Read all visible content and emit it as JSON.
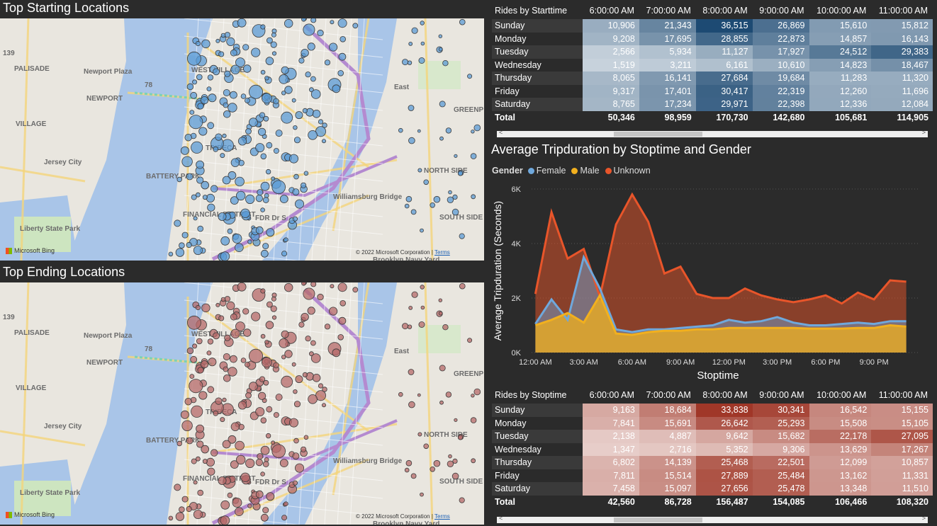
{
  "maps": [
    {
      "title": "Top Starting Locations",
      "labels": [
        "PALISADE",
        "Newport Plaza",
        "NEWPORT",
        "VILLAGE",
        "Jersey City",
        "WEST VILLAGE",
        "TRIBECA",
        "BATTERY PARK",
        "FINANCIAL DISTRICT",
        "Liberty State Park",
        "East",
        "GREENP",
        "NORTH SIDE",
        "SOUTH SIDE",
        "Brooklyn Navy Yard",
        "Williamsburg Bridge",
        "FDR Dr S",
        "78",
        "139"
      ],
      "bing": "Microsoft Bing",
      "copyright": "© 2022 Microsoft Corporation",
      "terms": "Terms",
      "bubble_color": "#5b9bd5"
    },
    {
      "title": "Top Ending Locations",
      "labels": [
        "PALISADE",
        "Newport Plaza",
        "NEWPORT",
        "VILLAGE",
        "Jersey City",
        "WEST VILLAGE",
        "TRIBECA",
        "BATTERY PARK",
        "FINANCIAL DISTRICT",
        "Liberty State Park",
        "East",
        "GREENP",
        "NORTH SIDE",
        "SOUTH SIDE",
        "Brooklyn Navy Yard",
        "Williamsburg Bridge",
        "FDR Dr S",
        "78",
        "139"
      ],
      "bing": "Microsoft Bing",
      "copyright": "© 2022 Microsoft Corporation",
      "terms": "Terms",
      "bubble_color": "#b56a6a"
    }
  ],
  "start_table": {
    "row_header": "Rides by Starttime",
    "columns": [
      "6:00:00 AM",
      "7:00:00 AM",
      "8:00:00 AM",
      "9:00:00 AM",
      "10:00:00 AM",
      "11:00:00 AM"
    ],
    "rows": [
      {
        "label": "Sunday",
        "values": [
          "10,906",
          "21,343",
          "36,515",
          "26,869",
          "15,610",
          "15,812"
        ]
      },
      {
        "label": "Monday",
        "values": [
          "9,208",
          "17,695",
          "28,855",
          "22,873",
          "14,857",
          "16,143"
        ]
      },
      {
        "label": "Tuesday",
        "values": [
          "2,566",
          "5,934",
          "11,127",
          "17,927",
          "24,512",
          "29,383"
        ]
      },
      {
        "label": "Wednesday",
        "values": [
          "1,519",
          "3,211",
          "6,161",
          "10,610",
          "14,823",
          "18,467"
        ]
      },
      {
        "label": "Thursday",
        "values": [
          "8,065",
          "16,141",
          "27,684",
          "19,684",
          "11,283",
          "11,320"
        ]
      },
      {
        "label": "Friday",
        "values": [
          "9,317",
          "17,401",
          "30,417",
          "22,319",
          "12,260",
          "11,696"
        ]
      },
      {
        "label": "Saturday",
        "values": [
          "8,765",
          "17,234",
          "29,971",
          "22,398",
          "12,336",
          "12,084"
        ]
      }
    ],
    "total_label": "Total",
    "totals": [
      "50,346",
      "98,959",
      "170,730",
      "142,680",
      "105,681",
      "114,905"
    ],
    "color": "#1f4e79"
  },
  "stop_table": {
    "row_header": "Rides by Stoptime",
    "columns": [
      "6:00:00 AM",
      "7:00:00 AM",
      "8:00:00 AM",
      "9:00:00 AM",
      "10:00:00 AM",
      "11:00:00 AM"
    ],
    "rows": [
      {
        "label": "Sunday",
        "values": [
          "9,163",
          "18,684",
          "33,838",
          "30,341",
          "16,542",
          "15,155"
        ]
      },
      {
        "label": "Monday",
        "values": [
          "7,841",
          "15,691",
          "26,642",
          "25,293",
          "15,508",
          "15,105"
        ]
      },
      {
        "label": "Tuesday",
        "values": [
          "2,138",
          "4,887",
          "9,642",
          "15,682",
          "22,178",
          "27,095"
        ]
      },
      {
        "label": "Wednesday",
        "values": [
          "1,347",
          "2,716",
          "5,352",
          "9,306",
          "13,629",
          "17,267"
        ]
      },
      {
        "label": "Thursday",
        "values": [
          "6,802",
          "14,139",
          "25,468",
          "22,501",
          "12,099",
          "10,857"
        ]
      },
      {
        "label": "Friday",
        "values": [
          "7,811",
          "15,514",
          "27,889",
          "25,484",
          "13,162",
          "11,331"
        ]
      },
      {
        "label": "Saturday",
        "values": [
          "7,458",
          "15,097",
          "27,656",
          "25,478",
          "13,348",
          "11,510"
        ]
      }
    ],
    "total_label": "Total",
    "totals": [
      "42,560",
      "86,728",
      "156,487",
      "154,085",
      "106,466",
      "108,320"
    ],
    "color": "#a83a2a"
  },
  "chart_data": {
    "type": "area",
    "title": "Average Tripduration by Stoptime and Gender",
    "legend_title": "Gender",
    "xlabel": "Stoptime",
    "ylabel": "Average Tripduration (Seconds)",
    "x": [
      "12:00 AM",
      "1:00 AM",
      "2:00 AM",
      "3:00 AM",
      "4:00 AM",
      "5:00 AM",
      "6:00 AM",
      "7:00 AM",
      "8:00 AM",
      "9:00 AM",
      "10:00 AM",
      "11:00 AM",
      "12:00 PM",
      "1:00 PM",
      "2:00 PM",
      "3:00 PM",
      "4:00 PM",
      "5:00 PM",
      "6:00 PM",
      "7:00 PM",
      "8:00 PM",
      "9:00 PM",
      "10:00 PM",
      "11:00 PM"
    ],
    "x_tick_labels": [
      "12:00 AM",
      "3:00 AM",
      "6:00 AM",
      "9:00 AM",
      "12:00 PM",
      "3:00 PM",
      "6:00 PM",
      "9:00 PM"
    ],
    "y_ticks": [
      "0K",
      "2K",
      "4K",
      "6K"
    ],
    "ylim": [
      0,
      6000
    ],
    "series": [
      {
        "name": "Unknown",
        "color": "#e8552a",
        "values": [
          2150,
          5150,
          3450,
          3800,
          2050,
          4700,
          5800,
          4800,
          2900,
          3150,
          2150,
          2000,
          2000,
          2350,
          2100,
          1950,
          1850,
          1950,
          2100,
          1800,
          2200,
          1950,
          2650,
          2600
        ]
      },
      {
        "name": "Female",
        "color": "#6fa8dc",
        "values": [
          1050,
          1950,
          1200,
          3500,
          2350,
          850,
          750,
          850,
          850,
          900,
          950,
          1000,
          1200,
          1100,
          1150,
          1300,
          1100,
          1000,
          1000,
          1050,
          1100,
          1050,
          1150,
          1150
        ]
      },
      {
        "name": "Male",
        "color": "#f2b01e",
        "values": [
          1000,
          1200,
          1450,
          1100,
          2100,
          700,
          650,
          750,
          800,
          800,
          850,
          850,
          900,
          900,
          900,
          900,
          900,
          880,
          880,
          880,
          900,
          900,
          1000,
          950
        ]
      }
    ],
    "legend_order": [
      "Female",
      "Male",
      "Unknown"
    ]
  }
}
